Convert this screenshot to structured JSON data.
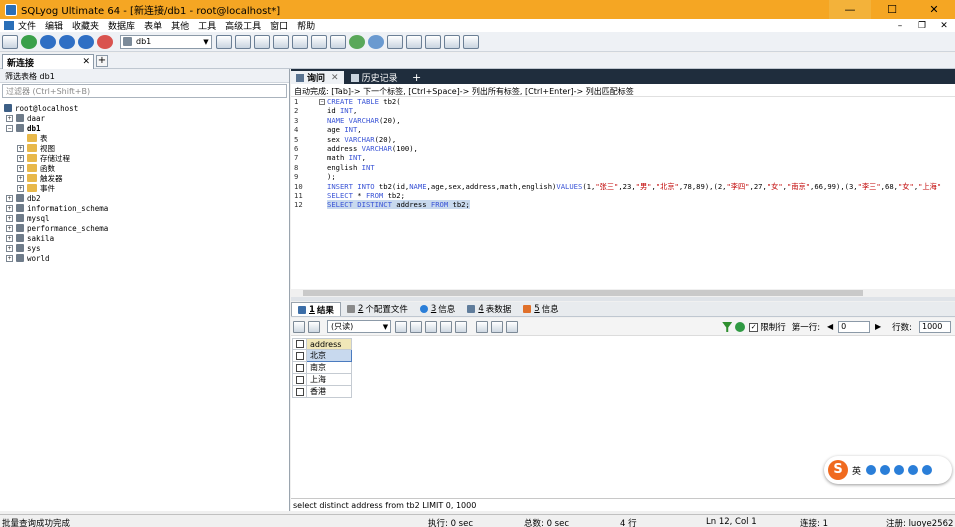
{
  "window": {
    "title": "SQLyog Ultimate 64 - [新连接/db1 - root@localhost*]",
    "min": "—",
    "max": "☐",
    "close": "✕"
  },
  "menu": {
    "items": [
      "文件",
      "编辑",
      "收藏夹",
      "数据库",
      "表单",
      "其他",
      "工具",
      "高级工具",
      "窗口",
      "帮助"
    ],
    "mdi_min": "–",
    "mdi_restore": "❐",
    "mdi_close": "✕"
  },
  "toolbar": {
    "db_selector": "db1"
  },
  "connection_tab": {
    "label": "新连接",
    "close": "✕",
    "add": "+"
  },
  "object_browser": {
    "filter_label": "筛选表格 db1",
    "filter_placeholder": "过滤器 (Ctrl+Shift+B)",
    "root": "root@localhost",
    "databases": [
      "daar",
      "db1",
      "db2",
      "information_schema",
      "mysql",
      "performance_schema",
      "sakila",
      "sys",
      "world"
    ],
    "db1_children": [
      "表",
      "视图",
      "存储过程",
      "函数",
      "触发器",
      "事件"
    ]
  },
  "editor_tabs": [
    {
      "label": "询问",
      "close": "✕"
    },
    {
      "label": "历史记录"
    }
  ],
  "editor_tab_add": "+",
  "hint": "自动完成: [Tab]-> 下一个标签, [Ctrl+Space]-> 列出所有标签, [Ctrl+Enter]-> 列出匹配标签",
  "line_numbers": [
    "1",
    "2",
    "3",
    "4",
    "5",
    "6",
    "7",
    "8",
    "9",
    "10",
    "11",
    "12"
  ],
  "result_tabs": [
    {
      "num": "1",
      "label": "结果"
    },
    {
      "num": "2",
      "label": "个配置文件"
    },
    {
      "num": "3",
      "label": "信息"
    },
    {
      "num": "4",
      "label": "表数据"
    },
    {
      "num": "5",
      "label": "信息"
    }
  ],
  "result_toolbar": {
    "mode": "(只读)",
    "limit_label": "限制行",
    "first_row_label": "第一行:",
    "first_row_value": "0",
    "rows_label": "行数:",
    "rows_value": "1000"
  },
  "result_grid": {
    "header": "address",
    "rows": [
      "北京",
      "南京",
      "上海",
      "香港"
    ]
  },
  "ime": {
    "brand": "S",
    "label": "英"
  },
  "query_status": "select distinct address from tb2 LIMIT 0, 1000",
  "statusbar": {
    "message": "批量查询成功完成",
    "exec": "执行: 0 sec",
    "total": "总数: 0 sec",
    "rows": "4 行",
    "pos": "Ln 12, Col 1",
    "conn": "连接: 1",
    "reg": "注册: luoye2562"
  }
}
